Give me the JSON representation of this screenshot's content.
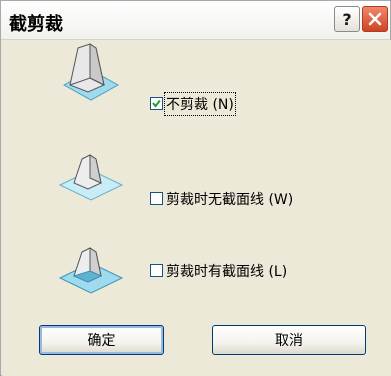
{
  "window": {
    "title": "截剪裁"
  },
  "options": [
    {
      "label": "不剪裁 (N)",
      "checked": true,
      "icon": "cube-no-clip-icon"
    },
    {
      "label": "剪裁时无截面线 (W)",
      "checked": false,
      "icon": "cube-clip-no-section-icon"
    },
    {
      "label": "剪裁时有截面线 (L)",
      "checked": false,
      "icon": "cube-clip-with-section-icon"
    }
  ],
  "buttons": {
    "ok_label": "确定",
    "cancel_label": "取消"
  },
  "colors": {
    "close_button": "#d04324",
    "accent_blue": "#3c7fb1",
    "plane_teal": "#7fd0e6"
  }
}
